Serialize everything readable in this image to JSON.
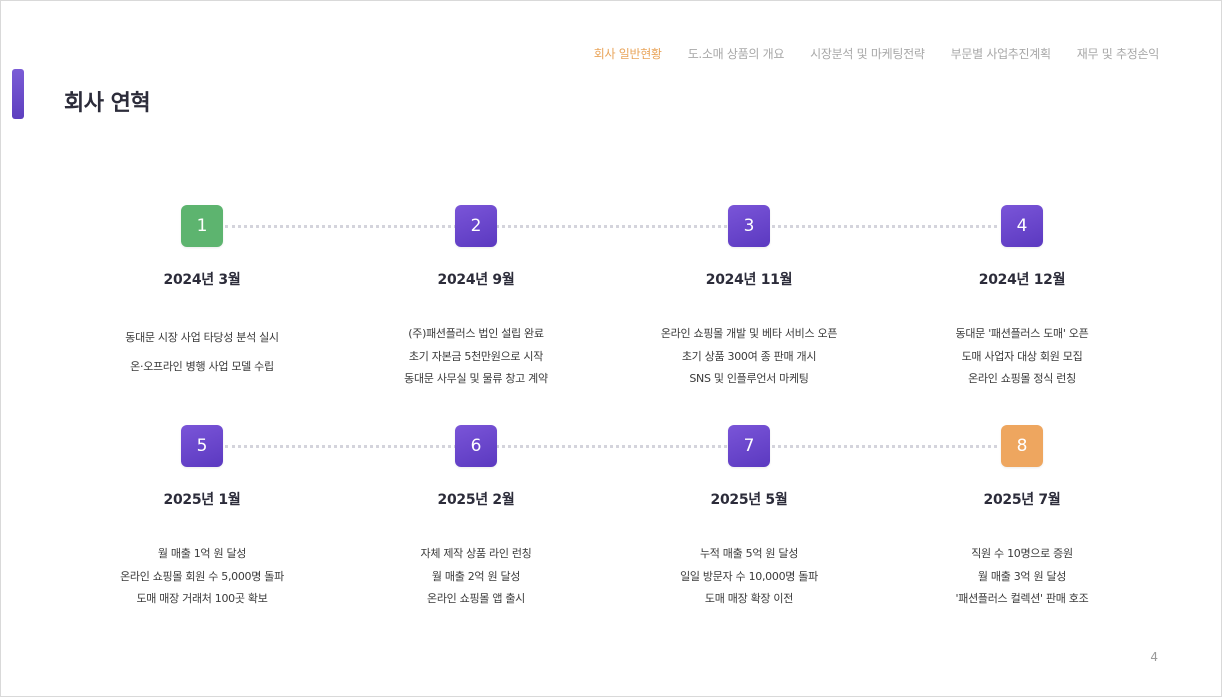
{
  "nav": [
    {
      "label": "회사 일반현황",
      "active": true
    },
    {
      "label": "도.소매 상품의 개요",
      "active": false
    },
    {
      "label": "시장분석 및 마케팅전략",
      "active": false
    },
    {
      "label": "부문별 사업추진계획",
      "active": false
    },
    {
      "label": "재무 및 추정손익",
      "active": false
    }
  ],
  "title": "회사 연혁",
  "milestones": [
    {
      "number": "1",
      "date": "2024년 3월",
      "color": "#5db46f",
      "lines": [
        "동대문 시장 사업 타당성 분석 실시",
        "온·오프라인 병행 사업 모델 수립"
      ]
    },
    {
      "number": "2",
      "date": "2024년 9월",
      "color": "#6a48cc",
      "lines": [
        "(주)패션플러스 법인 설립 완료",
        "초기 자본금 5천만원으로 시작",
        "동대문 사무실 및 물류 창고 계약"
      ]
    },
    {
      "number": "3",
      "date": "2024년 11월",
      "color": "#6a48cc",
      "lines": [
        "온라인 쇼핑몰 개발 및 베타 서비스 오픈",
        "초기 상품 300여 종 판매 개시",
        "SNS 및 인플루언서 마케팅"
      ]
    },
    {
      "number": "4",
      "date": "2024년 12월",
      "color": "#6a48cc",
      "lines": [
        "동대문 '패션플러스 도매' 오픈",
        "도매 사업자 대상 회원 모집",
        "온라인 쇼핑몰 정식 런칭"
      ]
    },
    {
      "number": "5",
      "date": "2025년 1월",
      "color": "#6a48cc",
      "lines": [
        "월 매출 1억 원 달성",
        "온라인 쇼핑몰 회원 수 5,000명 돌파",
        "도매 매장 거래처 100곳 확보"
      ]
    },
    {
      "number": "6",
      "date": "2025년 2월",
      "color": "#6a48cc",
      "lines": [
        "자체 제작 상품 라인 런칭",
        "월 매출 2억 원 달성",
        "온라인 쇼핑몰 앱 출시"
      ]
    },
    {
      "number": "7",
      "date": "2025년 5월",
      "color": "#6a48cc",
      "lines": [
        "누적 매출 5억 원 달성",
        "일일 방문자 수 10,000명 돌파",
        "도매 매장 확장 이전"
      ]
    },
    {
      "number": "8",
      "date": "2025년 7월",
      "color": "#eea65f",
      "lines": [
        "직원 수 10명으로 증원",
        "월 매출 3억 원 달성",
        "'패션플러스 컬렉션' 판매 호조"
      ]
    }
  ],
  "page_number": "4"
}
